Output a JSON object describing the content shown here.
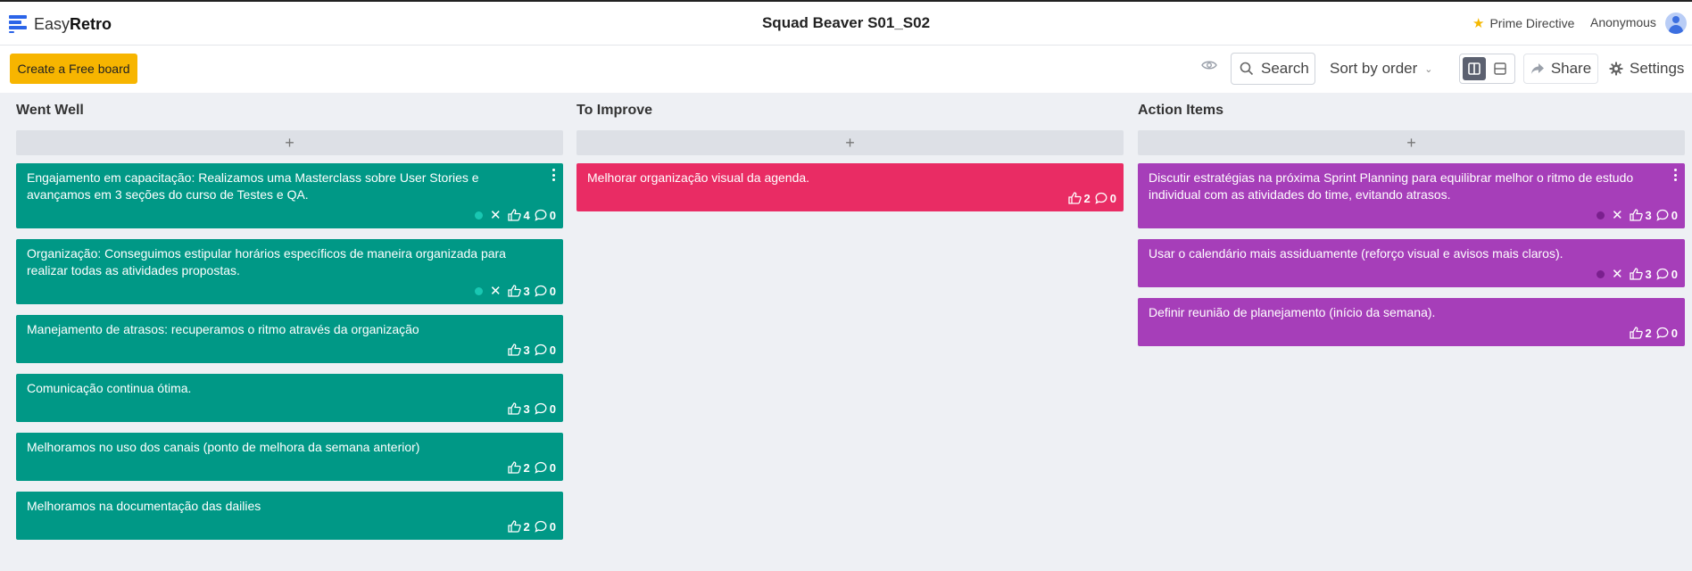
{
  "app": {
    "logo_light": "Easy",
    "logo_bold": "Retro",
    "board_title": "Squad Beaver S01_S02"
  },
  "header": {
    "prime_directive": "Prime Directive",
    "user": "Anonymous"
  },
  "toolbar": {
    "create_board": "Create a Free board",
    "search_label": "Search",
    "sort_label": "Sort by order",
    "share_label": "Share",
    "settings_label": "Settings"
  },
  "colors": {
    "went_well": "#009886",
    "to_improve": "#e92c64",
    "action_items": "#a63eb9",
    "accent": "#f7b500"
  },
  "columns": [
    {
      "title": "Went Well",
      "add_label": "+",
      "cards": [
        {
          "text": "Engajamento em capacitação: Realizamos uma Masterclass sobre User Stories e avançamos em 3 seções do curso de Testes e QA.",
          "votes": "4",
          "comments": "0"
        },
        {
          "text": "Organização: Conseguimos estipular horários específicos de maneira organizada para realizar todas as atividades propostas.",
          "votes": "3",
          "comments": "0"
        },
        {
          "text": "Manejamento de atrasos: recuperamos o ritmo através da organização",
          "votes": "3",
          "comments": "0"
        },
        {
          "text": "Comunicação continua ótima.",
          "votes": "3",
          "comments": "0"
        },
        {
          "text": "Melhoramos no uso dos canais (ponto de melhora da semana anterior)",
          "votes": "2",
          "comments": "0"
        },
        {
          "text": "Melhoramos na documentação das dailies",
          "votes": "2",
          "comments": "0"
        }
      ]
    },
    {
      "title": "To Improve",
      "add_label": "+",
      "cards": [
        {
          "text": "Melhorar organização visual da agenda.",
          "votes": "2",
          "comments": "0"
        }
      ]
    },
    {
      "title": "Action Items",
      "add_label": "+",
      "cards": [
        {
          "text": "Discutir estratégias na próxima Sprint Planning para equilibrar melhor o ritmo de estudo individual com as atividades do time, evitando atrasos.",
          "votes": "3",
          "comments": "0"
        },
        {
          "text": "Usar o calendário mais assiduamente (reforço visual e avisos mais claros).",
          "votes": "3",
          "comments": "0"
        },
        {
          "text": "Definir reunião de planejamento (início da semana).",
          "votes": "2",
          "comments": "0"
        }
      ]
    }
  ]
}
